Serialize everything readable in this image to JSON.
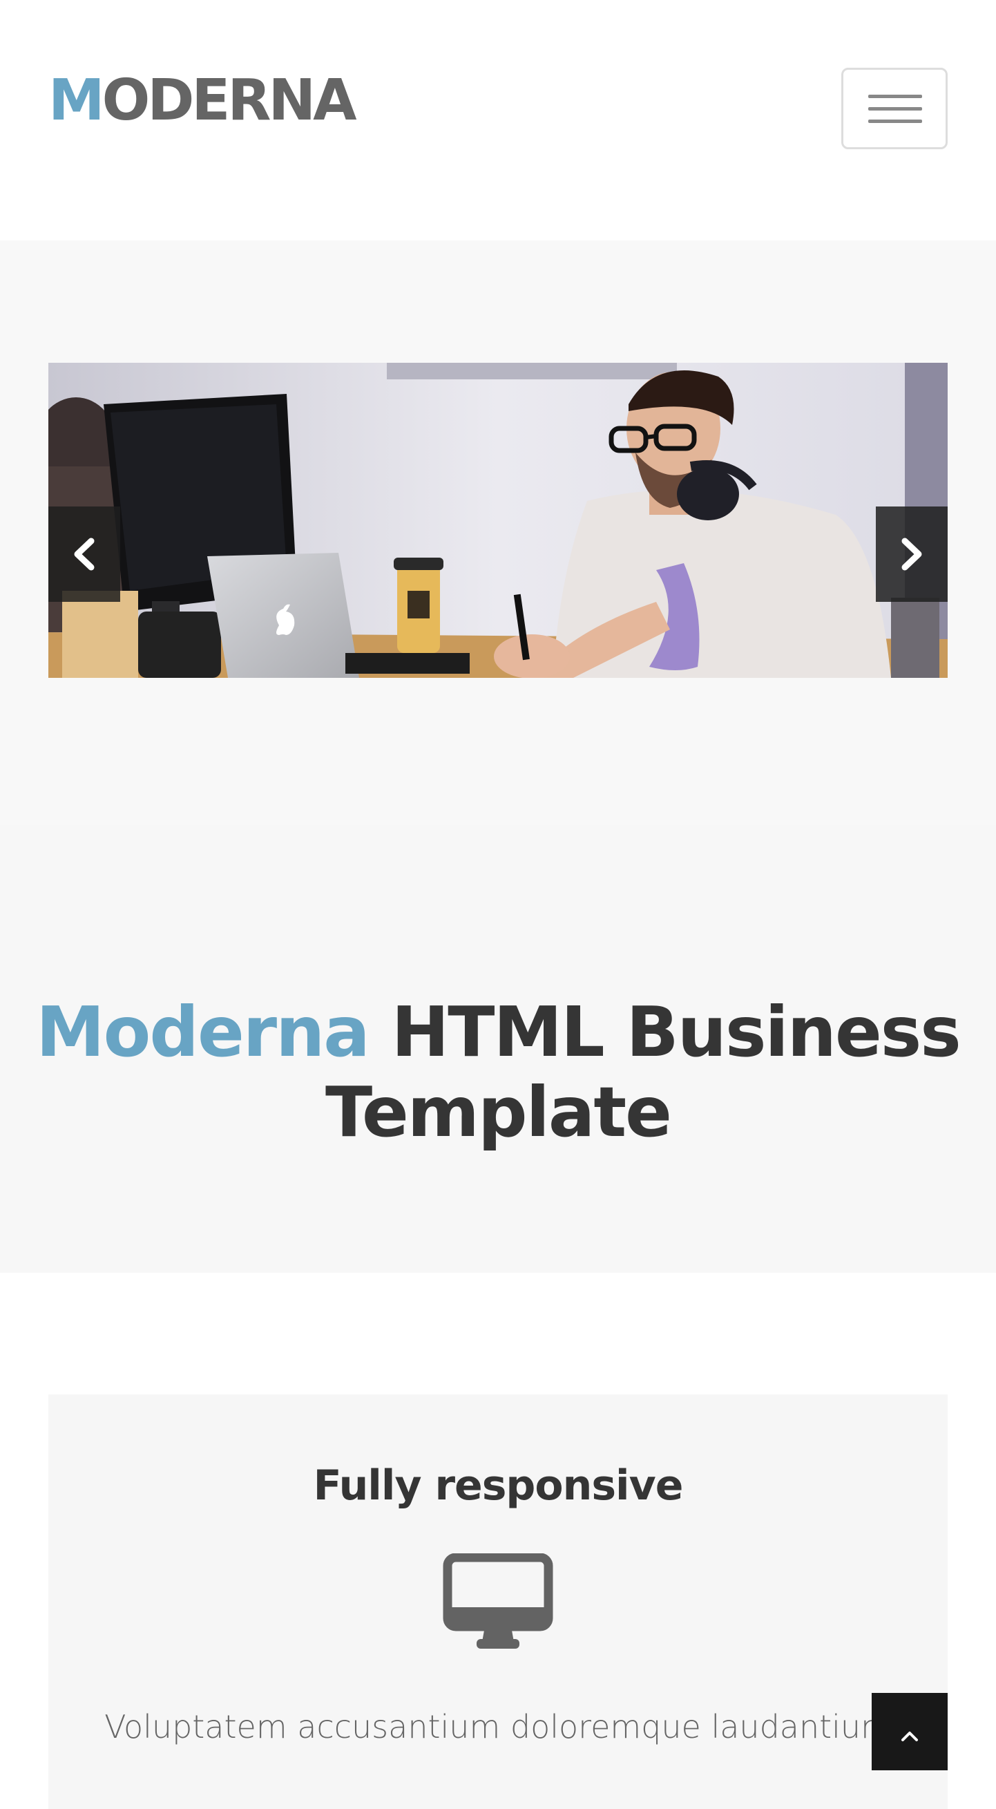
{
  "header": {
    "logo_first": "M",
    "logo_rest": "ODERNA",
    "menu_toggle": "menu-icon"
  },
  "slider": {
    "image": "man working at desk with laptop, headphones and coffee cup",
    "prev_icon": "chevron-left-icon",
    "next_icon": "chevron-right-icon"
  },
  "headline": {
    "accent": "Moderna",
    "rest": "HTML Business Template"
  },
  "feature": {
    "title": "Fully responsive",
    "icon": "desktop-icon",
    "text": "Voluptatem accusantium doloremque laudantium"
  },
  "scroll_top": {
    "icon": "chevron-up-icon"
  },
  "colors": {
    "accent": "#68a4c4",
    "logo_gray": "#656565",
    "heading": "#353535",
    "band_background": "#f7f7f7"
  }
}
